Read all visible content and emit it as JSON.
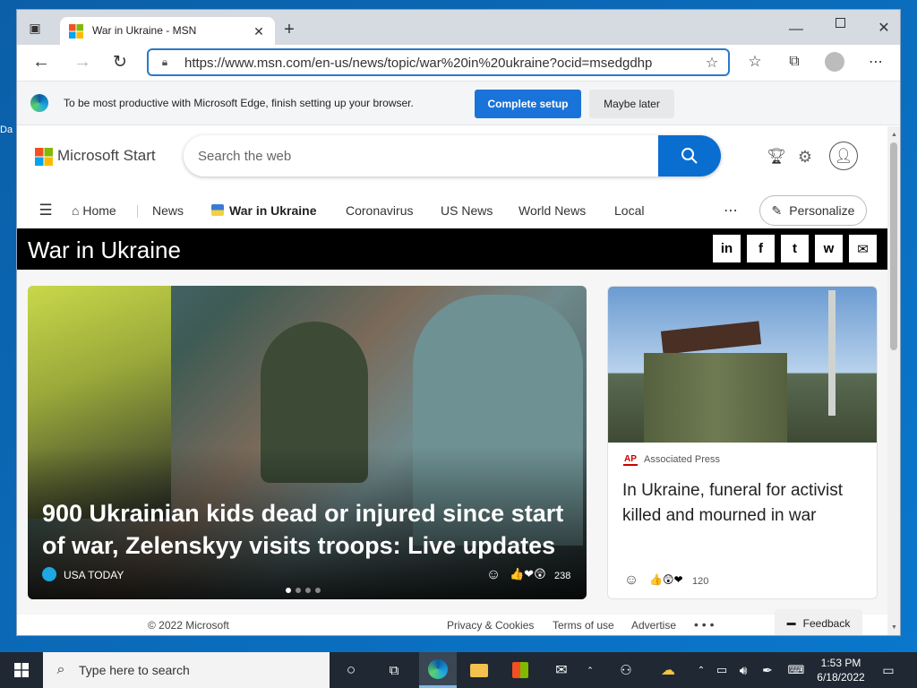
{
  "desktop": {
    "icon_label": "Da"
  },
  "browser": {
    "tab_title": "War in Ukraine - MSN",
    "url": "https://www.msn.com/en-us/news/topic/war%20in%20ukraine?ocid=msedgdhp",
    "infobar": {
      "message": "To be most productive with Microsoft Edge, finish setting up your browser.",
      "primary": "Complete setup",
      "secondary": "Maybe later"
    }
  },
  "site": {
    "brand": "Microsoft Start",
    "search_placeholder": "Search the web",
    "nav": [
      "Home",
      "News",
      "War in Ukraine",
      "Coronavirus",
      "US News",
      "World News",
      "Local"
    ],
    "personalize": "Personalize",
    "topic_title": "War in Ukraine",
    "social": [
      "in",
      "f",
      "t",
      "w",
      "✉"
    ],
    "hero_story": {
      "headline": "900 Ukrainian kids dead or injured since start of war, Zelenskyy visits troops: Live updates",
      "source": "USA TODAY",
      "reactions": "238"
    },
    "side_story": {
      "source": "Associated Press",
      "source_badge": "AP",
      "headline": "In Ukraine, funeral for activist killed and mourned in war",
      "reactions": "120"
    },
    "footer": {
      "copyright": "© 2022 Microsoft",
      "links": [
        "Privacy & Cookies",
        "Terms of use",
        "Advertise"
      ],
      "feedback": "Feedback"
    }
  },
  "taskbar": {
    "search_placeholder": "Type here to search",
    "time": "1:53 PM",
    "date": "6/18/2022"
  },
  "colors": {
    "accent": "#0a6ed1",
    "infobar_btn": "#1a73d8"
  }
}
